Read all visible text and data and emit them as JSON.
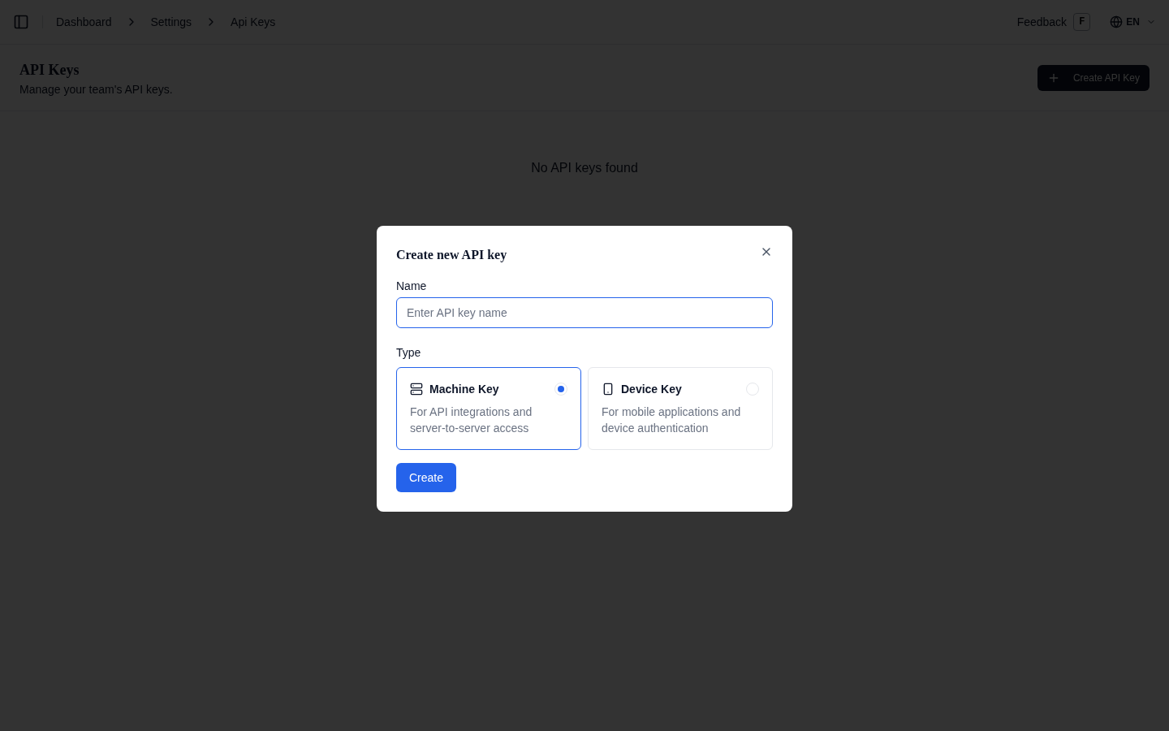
{
  "breadcrumbs": [
    {
      "label": "Dashboard"
    },
    {
      "label": "Settings"
    },
    {
      "label": "Api Keys"
    }
  ],
  "header": {
    "feedback": "Feedback",
    "feedback_shortcut": "F",
    "language": "EN"
  },
  "page": {
    "title": "API Keys",
    "subtitle": "Manage your team's API keys.",
    "create_button": "Create API Key",
    "empty_message": "No API keys found"
  },
  "dialog": {
    "title": "Create new API key",
    "name_label": "Name",
    "name_placeholder": "Enter API key name",
    "type_label": "Type",
    "types": [
      {
        "kind": "machine",
        "title": "Machine Key",
        "description": "For API integrations and server-to-server access",
        "selected": true
      },
      {
        "kind": "device",
        "title": "Device Key",
        "description": "For mobile applications and device authentication",
        "selected": false
      }
    ],
    "submit": "Create"
  }
}
